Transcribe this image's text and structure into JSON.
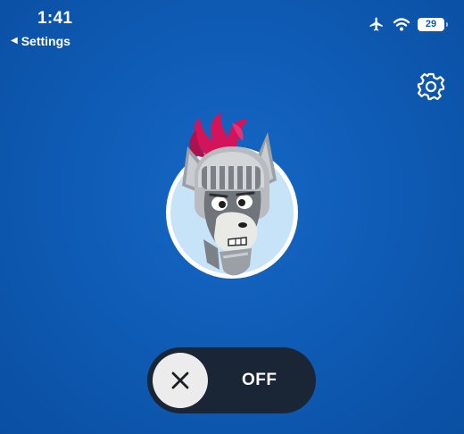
{
  "status_bar": {
    "time": "1:41",
    "back_label": "Settings",
    "battery_level": "29",
    "icons": [
      "airplane-icon",
      "wifi-icon",
      "battery-icon"
    ]
  },
  "header": {
    "settings_icon": "gear-icon"
  },
  "main": {
    "avatar": "knight-donkey-mascot",
    "toggle": {
      "state_label": "OFF",
      "icon": "close-icon"
    }
  },
  "colors": {
    "background": "#0f5cb6",
    "toggle_bg": "#1a2535",
    "knob": "#ececec",
    "plume": "#d4145a"
  }
}
